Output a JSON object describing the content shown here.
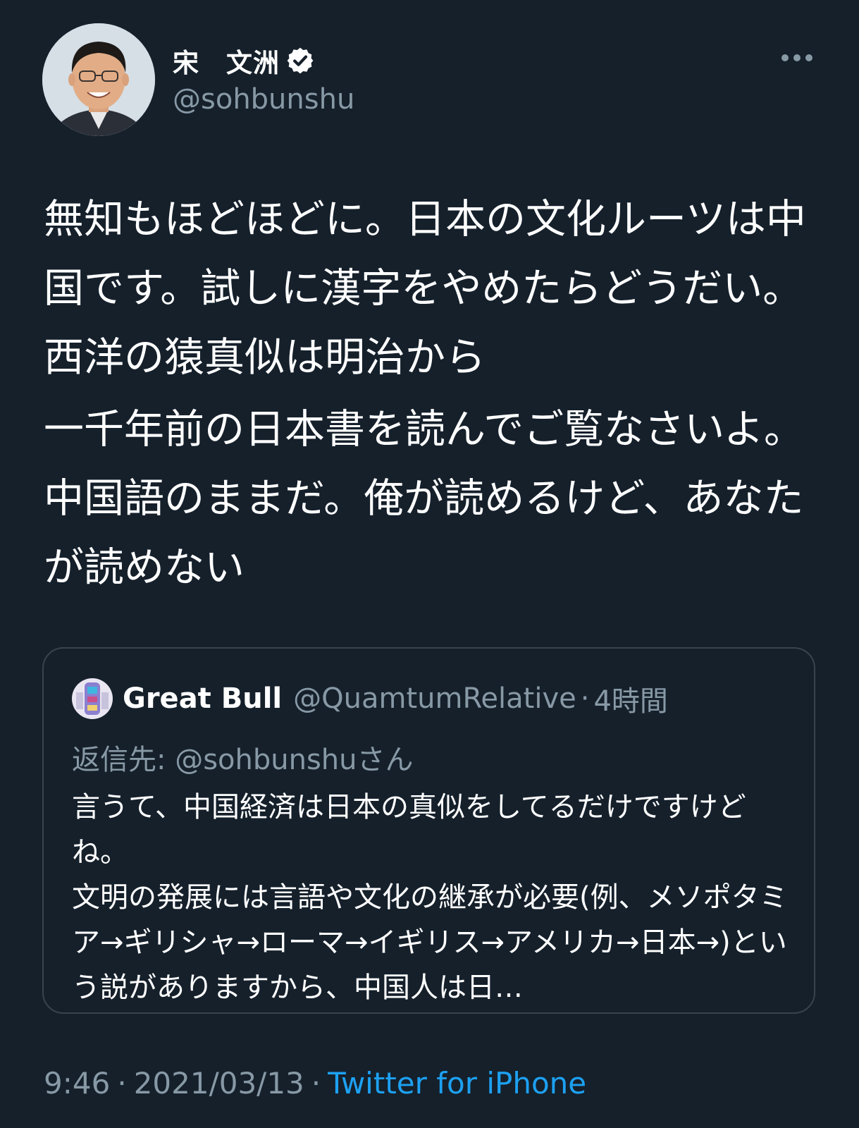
{
  "author": {
    "display_name": "宋　文洲",
    "handle": "@sohbunshu",
    "verified_icon": "verified-badge-icon",
    "avatar_icon": "avatar-photo"
  },
  "tweet": {
    "paragraphs": [
      "無知もほどほどに。日本の文化ルーツは中国です。試しに漢字をやめたらどうだい。西洋の猿真似は明治から",
      "一千年前の日本書を読んでご覧なさいよ。中国語のままだ。俺が読めるけど、あなたが読めない"
    ]
  },
  "quoted_tweet": {
    "display_name": "Great Bull",
    "handle": "@QuamtumRelative",
    "separator": "·",
    "time": "4時間",
    "reply_prefix": "返信先: ",
    "reply_handle": "@sohbunshu",
    "reply_suffix": "さん",
    "text_lines": [
      "言うて、中国経済は日本の真似をしてるだけですけどね。",
      "文明の発展には言語や文化の継承が必要(例、メソポタミア→ギリシャ→ローマ→イギリス→アメリカ→日本→)という説がありますから、中国人は日…"
    ]
  },
  "footer": {
    "time": "9:46",
    "separator": "·",
    "date": "2021/03/13",
    "source": "Twitter for iPhone"
  },
  "colors": {
    "background": "#15202b",
    "text_primary": "#ffffff",
    "text_secondary": "#8899a6",
    "link": "#1da1f2",
    "border": "#38444d"
  }
}
